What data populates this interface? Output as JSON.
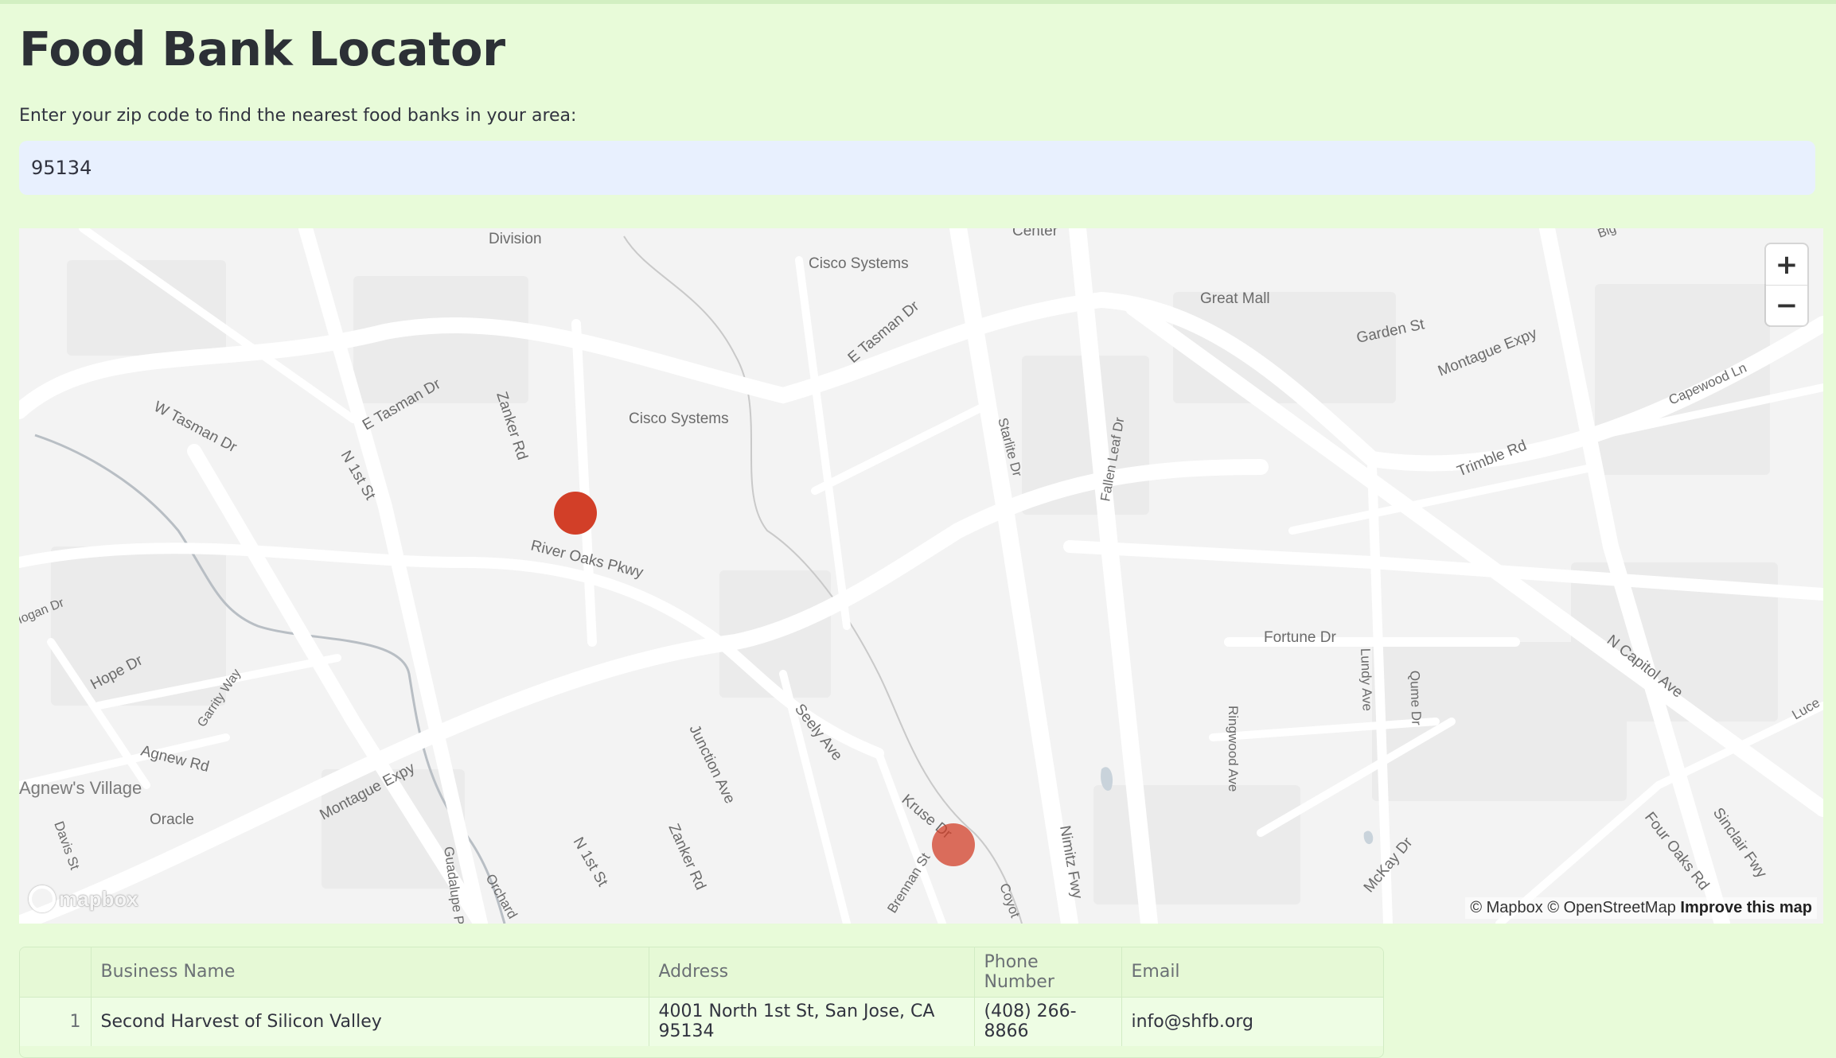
{
  "page": {
    "title": "Food Bank Locator",
    "instruction": "Enter your zip code to find the nearest food banks in your area:"
  },
  "search": {
    "value": "95134"
  },
  "map": {
    "zoom_in_label": "+",
    "zoom_out_label": "−",
    "attribution": "© Mapbox © OpenStreetMap",
    "improve_link": "Improve this map",
    "logo": "mapbox",
    "marker_color": "#d23f28",
    "labels": {
      "division": "Division",
      "cisco_systems_top": "Cisco Systems",
      "center": "Center",
      "great_mall": "Great Mall",
      "garden_st": "Garden St",
      "montague_expy_ne": "Montague Expy",
      "big": "Big",
      "capewood_ln": "Capewood Ln",
      "trimble_rd": "Trimble Rd",
      "e_tasman_dr_w": "E Tasman Dr",
      "e_tasman_dr_e": "E Tasman Dr",
      "w_tasman_dr": "W Tasman Dr",
      "zanker_rd_n": "Zanker Rd",
      "n_1st_st_n": "N 1st St",
      "cisco_systems_mid": "Cisco Systems",
      "starlite_dr": "Starlite Dr",
      "fallen_leaf_dr": "Fallen Leaf Dr",
      "river_oaks_pkwy": "River Oaks Pkwy",
      "hogan_dr": "Hogan Dr",
      "fortune_dr": "Fortune Dr",
      "lundy_ave": "Lundy Ave",
      "qume_dr": "Qume Dr",
      "n_capitol_ave": "N Capitol Ave",
      "hope_dr": "Hope Dr",
      "garrity_way": "Garrity Way",
      "seely_ave": "Seely Ave",
      "junction_ave": "Junction Ave",
      "agnew_rd": "Agnew Rd",
      "ringwood_ave": "Ringwood Ave",
      "agnews_village": "Agnew's Village",
      "montague_expy_sw": "Montague Expy",
      "oracle": "Oracle",
      "kruse_dr": "Kruse Dr",
      "four_oaks_rd": "Four Oaks Rd",
      "sinclair_fwy": "Sinclair Fwy",
      "mckay_dr": "McKay Dr",
      "nimitz_fwy": "Nimitz Fwy",
      "davis_st": "Davis St",
      "guadalupe": "Guadalupe P",
      "orchard": "Orchard",
      "n_1st_st_s": "N 1st St",
      "zanker_rd_s": "Zanker Rd",
      "brennan_st": "Brennan St",
      "coyote": "Coyot",
      "luce": "Luce"
    }
  },
  "table": {
    "columns": [
      "",
      "Business Name",
      "Address",
      "Phone Number",
      "Email"
    ],
    "rows": [
      {
        "index": "1",
        "name": "Second Harvest of Silicon Valley",
        "address": "4001 North 1st St, San Jose, CA 95134",
        "phone": "(408) 266-8866",
        "email": "info@shfb.org"
      }
    ]
  }
}
